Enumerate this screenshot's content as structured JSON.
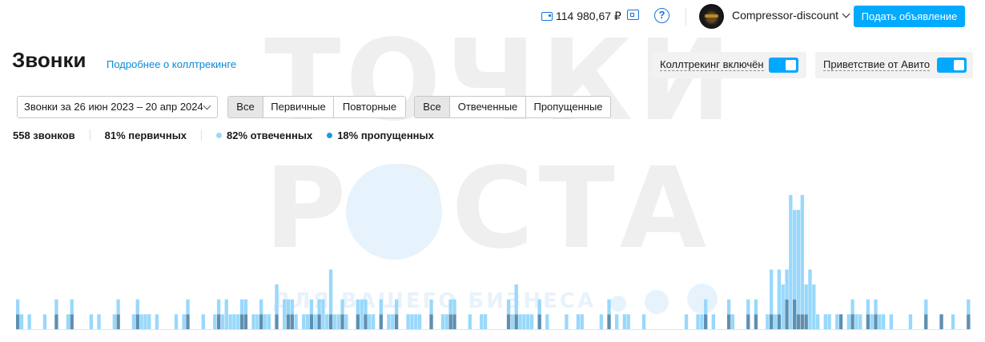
{
  "watermark": {
    "line1": "ТОЧКИ",
    "line2": "РОСТА",
    "line3": "ДЛЯ ВАШЕГО БИЗНЕСА"
  },
  "header": {
    "balance": "114 980,67 ₽",
    "help_symbol": "?",
    "account_name": "Compressor-discount",
    "post_button": "Подать объявление"
  },
  "page": {
    "title": "Звонки",
    "more_link": "Подробнее о коллтрекинге",
    "toggles": [
      {
        "label": "Коллтрекинг включён",
        "on": true
      },
      {
        "label": "Приветствие от Авито",
        "on": true
      }
    ]
  },
  "filters": {
    "date_range": "Звонки за 26 июн 2023 – 20 апр 2024",
    "type_segment": [
      "Все",
      "Первичные",
      "Повторные"
    ],
    "status_segment": [
      "Все",
      "Отвеченные",
      "Пропущенные"
    ]
  },
  "stats": {
    "total": "558 звонков",
    "primary": "81% первичных",
    "answered": "82% отвеченных",
    "missed": "18% пропущенных"
  },
  "colors": {
    "accent": "#00aaff",
    "link": "#0a8ad6",
    "answered": "#99d8fb",
    "missed": "#1a9ae0",
    "missed_bar": "#5f8fb0"
  },
  "chart_data": {
    "type": "bar",
    "stacked": true,
    "ylim": [
      0,
      12
    ],
    "series": [
      {
        "name": "82% отвеченных",
        "values": [
          1,
          1,
          0,
          1,
          0,
          0,
          0,
          1,
          0,
          0,
          1,
          0,
          0,
          1,
          1,
          0,
          0,
          0,
          0,
          1,
          0,
          1,
          0,
          0,
          0,
          1,
          1,
          0,
          0,
          0,
          1,
          1,
          1,
          1,
          1,
          0,
          1,
          0,
          0,
          0,
          0,
          1,
          0,
          1,
          1,
          0,
          0,
          0,
          1,
          0,
          0,
          1,
          1,
          1,
          2,
          1,
          1,
          1,
          1,
          1,
          0,
          1,
          1,
          1,
          1,
          1,
          0,
          2,
          0,
          2,
          1,
          1,
          1,
          0,
          1,
          1,
          1,
          1,
          1,
          2,
          1,
          3,
          1,
          1,
          1,
          1,
          0,
          0,
          1,
          2,
          1,
          1,
          1,
          0,
          1,
          0,
          1,
          1,
          1,
          0,
          0,
          1,
          1,
          1,
          1,
          0,
          0,
          1,
          0,
          0,
          1,
          1,
          1,
          1,
          0,
          0,
          0,
          1,
          0,
          0,
          1,
          1,
          0,
          0,
          0,
          0,
          0,
          1,
          1,
          2,
          1,
          1,
          1,
          1,
          0,
          1,
          0,
          1,
          0,
          0,
          0,
          0,
          1,
          0,
          0,
          1,
          1,
          0,
          0,
          0,
          0,
          1,
          0,
          1,
          0,
          1,
          0,
          1,
          1,
          0,
          0,
          0,
          1,
          0,
          0,
          0,
          0,
          0,
          0,
          0,
          0,
          0,
          0,
          1,
          0,
          0,
          1,
          1,
          1,
          0,
          1,
          0,
          0,
          0,
          1,
          1,
          0,
          0,
          0,
          1,
          0,
          1,
          0,
          0,
          1,
          3,
          1,
          3,
          3,
          2,
          9,
          6,
          7,
          8,
          2,
          4,
          3,
          1,
          0,
          1,
          1,
          0,
          1,
          0,
          0,
          1,
          1,
          1,
          1,
          0,
          1,
          1,
          1,
          1,
          1,
          0,
          1,
          0,
          0,
          0,
          0,
          1,
          0,
          0,
          0,
          1,
          0,
          0,
          0,
          0,
          0,
          0,
          1,
          0,
          0,
          0,
          1
        ]
      },
      {
        "name": "18% пропущенных",
        "values": [
          1,
          0,
          0,
          0,
          0,
          0,
          0,
          0,
          0,
          0,
          1,
          0,
          0,
          0,
          1,
          0,
          0,
          0,
          0,
          0,
          0,
          0,
          0,
          0,
          0,
          0,
          1,
          0,
          0,
          0,
          0,
          1,
          0,
          0,
          0,
          0,
          0,
          0,
          0,
          0,
          0,
          0,
          0,
          0,
          1,
          0,
          0,
          0,
          0,
          0,
          0,
          0,
          1,
          0,
          0,
          0,
          0,
          0,
          1,
          1,
          0,
          0,
          0,
          1,
          0,
          0,
          0,
          1,
          0,
          0,
          1,
          1,
          0,
          0,
          0,
          0,
          1,
          0,
          1,
          0,
          0,
          1,
          0,
          0,
          1,
          0,
          0,
          0,
          1,
          0,
          1,
          0,
          0,
          0,
          1,
          0,
          0,
          0,
          1,
          0,
          0,
          0,
          0,
          0,
          0,
          0,
          0,
          1,
          0,
          0,
          0,
          0,
          1,
          1,
          0,
          0,
          0,
          0,
          0,
          0,
          0,
          0,
          0,
          0,
          0,
          0,
          0,
          1,
          0,
          1,
          0,
          0,
          0,
          0,
          0,
          1,
          0,
          0,
          0,
          0,
          0,
          0,
          0,
          0,
          0,
          0,
          0,
          0,
          0,
          0,
          0,
          0,
          0,
          1,
          0,
          0,
          0,
          0,
          0,
          0,
          0,
          0,
          0,
          0,
          0,
          0,
          0,
          0,
          0,
          0,
          0,
          0,
          0,
          0,
          0,
          0,
          0,
          0,
          1,
          0,
          0,
          0,
          0,
          0,
          1,
          0,
          0,
          0,
          0,
          1,
          0,
          1,
          0,
          0,
          0,
          1,
          0,
          1,
          0,
          2,
          0,
          2,
          1,
          1,
          1,
          0,
          0,
          0,
          0,
          0,
          0,
          0,
          0,
          1,
          0,
          0,
          1,
          0,
          0,
          0,
          1,
          0,
          1,
          0,
          0,
          0,
          0,
          0,
          0,
          0,
          0,
          0,
          0,
          0,
          0,
          1,
          0,
          0,
          0,
          1,
          0,
          0,
          0,
          0,
          0,
          0,
          1,
          0,
          0,
          0,
          1
        ]
      }
    ]
  }
}
